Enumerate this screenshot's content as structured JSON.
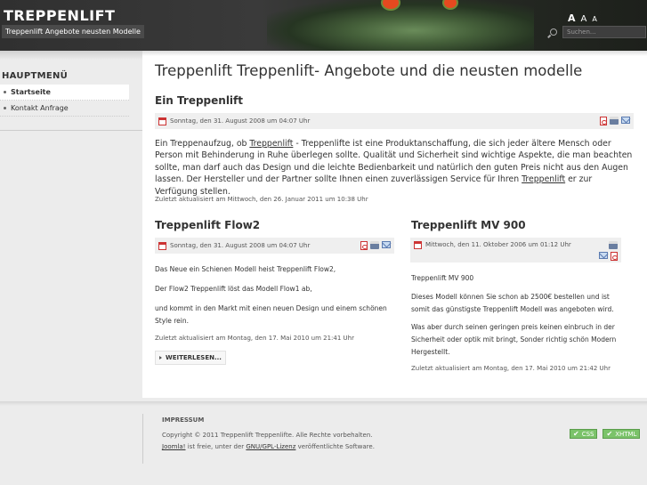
{
  "header": {
    "title": "TREPPENLIFT",
    "slogan": "Treppenlift Angebote neusten Modelle",
    "fontsize": {
      "increase": "A",
      "reset": "A",
      "decrease": "A"
    },
    "search_placeholder": "Suchen..."
  },
  "sidebar": {
    "title": "HAUPTMENÜ",
    "items": [
      {
        "label": "Startseite"
      },
      {
        "label": "Kontakt Anfrage"
      }
    ]
  },
  "main": {
    "page_title": "Treppenlift Treppenlift- Angebote und die neusten modelle",
    "lead": {
      "title": "Ein Treppenlift",
      "date": "Sonntag, den 31. August 2008 um 04:07 Uhr",
      "text_1": "Ein Treppenaufzug, ob ",
      "link_1": "Treppenlift",
      "text_2": " - Treppenlifte ist eine Produktanschaffung, die sich jeder ältere Mensch oder Person mit  Behinderung in Ruhe überlegen sollte. Qualität und Sicherheit sind wichtige Aspekte, die man beachten sollte, man darf auch das Design und die leichte Bedienbarkeit und natürlich den guten Preis nicht aus den Augen lassen. Der Hersteller und der Partner sollte Ihnen einen zuverlässigen Service für Ihren ",
      "link_2": "Treppenlift",
      "text_3": " er  zur Verfügung stellen.",
      "updated": "Zuletzt aktualisiert am Mittwoch, den 26. Januar 2011 um 10:38 Uhr"
    },
    "left": {
      "title": "Treppenlift Flow2",
      "date": "Sonntag, den 31. August 2008 um 04:07 Uhr",
      "p1": "Das Neue ein Schienen Modell heist Treppenlift Flow2,",
      "p2": "Der Flow2 Treppenlift löst das Modell Flow1 ab,",
      "p3": "und kommt in den Markt mit einen neuen Design und einem schönen Style rein.",
      "updated": "Zuletzt aktualisiert am Montag, den 17. Mai 2010 um 21:41 Uhr",
      "readmore": "WEITERLESEN..."
    },
    "right": {
      "title": "Treppenlift MV 900",
      "date": "Mittwoch, den 11. Oktober 2006 um 01:12 Uhr",
      "p1": "Treppenlift MV 900",
      "p2": "Dieses Modell können Sie schon ab 2500€ bestellen und ist somit das günstigste Treppenlift Modell was angeboten wird.",
      "p3": "Was aber durch seinen geringen preis keinen einbruch in der Sicherheit oder optik mit bringt, Sonder richtig schön Modern Hergestellt.",
      "updated": "Zuletzt aktualisiert am Montag, den 17. Mai 2010 um 21:42 Uhr"
    }
  },
  "footer": {
    "impressum": "IMPRESSUM",
    "copyright": "Copyright © 2011 Treppenlift Treppenlifte. Alle Rechte vorbehalten.",
    "joomla": "Joomla!",
    "license_text_1": " ist freie, unter der ",
    "license_link": "GNU/GPL-Lizenz",
    "license_text_2": " veröffentlichte Software.",
    "badge_css": "CSS",
    "badge_xhtml": "XHTML"
  },
  "colors": {
    "header_bg": "#303030",
    "badge_green": "#7bc36a",
    "meta_bar": "#efefef"
  }
}
